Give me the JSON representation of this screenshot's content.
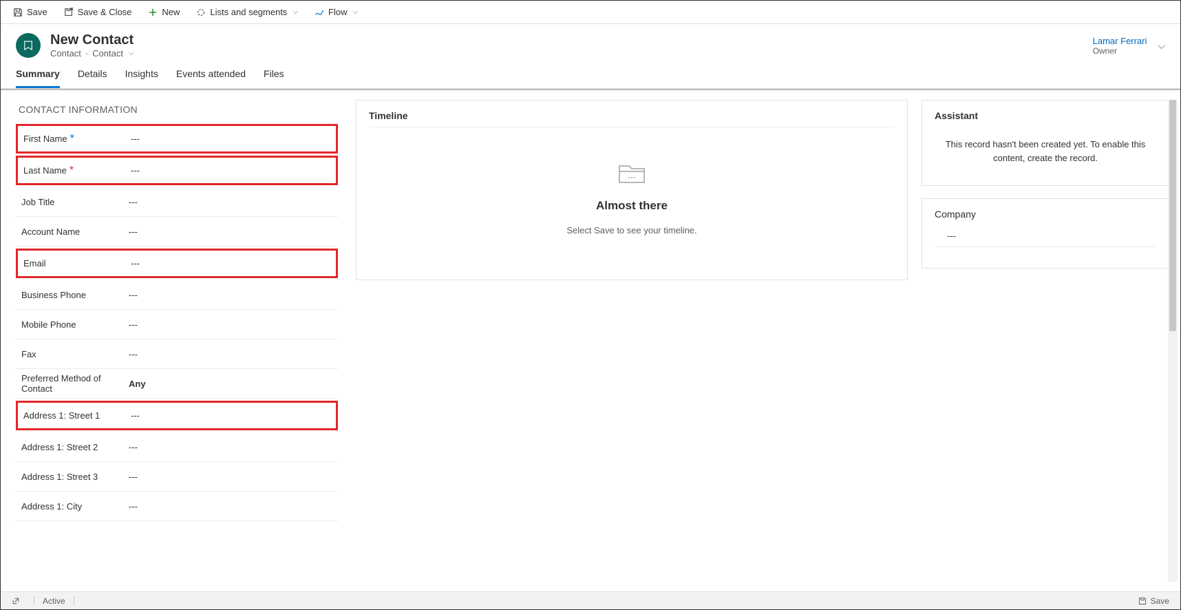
{
  "commands": {
    "save": "Save",
    "save_close": "Save & Close",
    "new": "New",
    "lists": "Lists and segments",
    "flow": "Flow"
  },
  "header": {
    "title": "New Contact",
    "subtitle_left": "Contact",
    "subtitle_right": "Contact",
    "owner_name": "Lamar Ferrari",
    "owner_label": "Owner"
  },
  "tabs": [
    "Summary",
    "Details",
    "Insights",
    "Events attended",
    "Files"
  ],
  "section": {
    "title": "CONTACT INFORMATION"
  },
  "fields": [
    {
      "label": "First Name",
      "value": "---",
      "required": "blue",
      "highlight": true
    },
    {
      "label": "Last Name",
      "value": "---",
      "required": "red",
      "highlight": true
    },
    {
      "label": "Job Title",
      "value": "---"
    },
    {
      "label": "Account Name",
      "value": "---"
    },
    {
      "label": "Email",
      "value": "---",
      "highlight": true
    },
    {
      "label": "Business Phone",
      "value": "---"
    },
    {
      "label": "Mobile Phone",
      "value": "---"
    },
    {
      "label": "Fax",
      "value": "---"
    },
    {
      "label": "Preferred Method of Contact",
      "value": "Any",
      "bold": true
    },
    {
      "label": "Address 1: Street 1",
      "value": "---",
      "highlight": true
    },
    {
      "label": "Address 1: Street 2",
      "value": "---"
    },
    {
      "label": "Address 1: Street 3",
      "value": "---"
    },
    {
      "label": "Address 1: City",
      "value": "---"
    }
  ],
  "timeline": {
    "title": "Timeline",
    "heading": "Almost there",
    "message": "Select Save to see your timeline."
  },
  "assistant": {
    "title": "Assistant",
    "message": "This record hasn't been created yet. To enable this content, create the record."
  },
  "company": {
    "title": "Company",
    "value": "---"
  },
  "statusbar": {
    "active": "Active",
    "save": "Save"
  }
}
